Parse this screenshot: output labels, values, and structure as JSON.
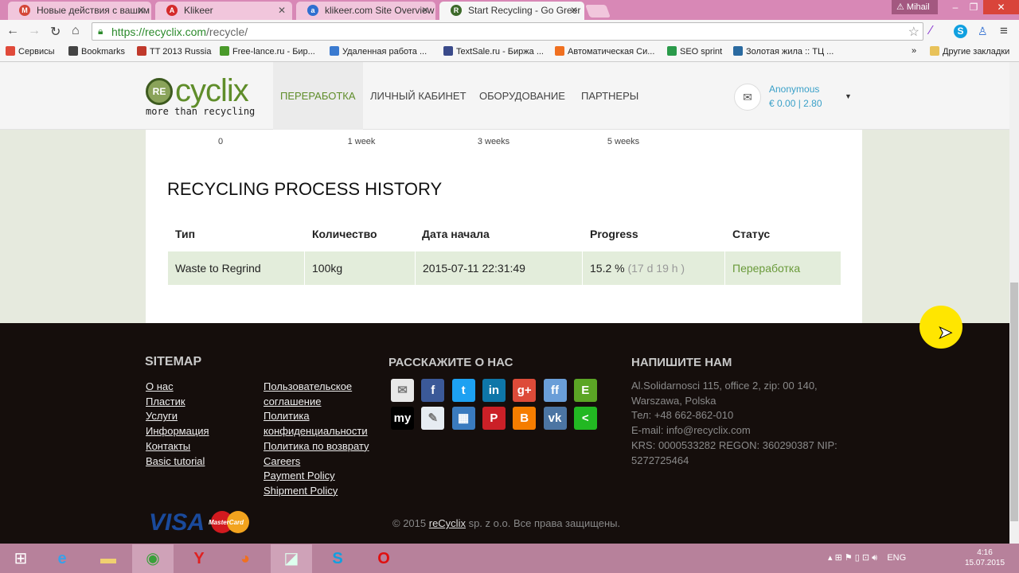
{
  "browser": {
    "tabs": [
      {
        "title": "Новые действия с вашим",
        "icon": "gmail-icon",
        "color": "#d44638",
        "glyph": "M"
      },
      {
        "title": "Klikeer",
        "icon": "klikeer-icon",
        "color": "#d42b2b",
        "glyph": "A"
      },
      {
        "title": "klikeer.com Site Overview",
        "icon": "site-overview-icon",
        "color": "#2f6fd0",
        "glyph": "a"
      },
      {
        "title": "Start Recycling - Go Greer",
        "icon": "recyclix-icon",
        "color": "#3d6a2a",
        "glyph": "R"
      }
    ],
    "user": "Mihail",
    "url_host": "https://recyclix.com",
    "url_path": "/recycle/",
    "bookmarks": [
      {
        "label": "Сервисы",
        "color": "#e04a3a"
      },
      {
        "label": "Bookmarks",
        "color": "#444"
      },
      {
        "label": "TT 2013 Russia",
        "color": "#c0392b"
      },
      {
        "label": "Free-lance.ru - Бир...",
        "color": "#4a9a2a"
      },
      {
        "label": "Удаленная работа ...",
        "color": "#3a7ad0"
      },
      {
        "label": "TextSale.ru - Биржа ...",
        "color": "#3a4a8a"
      },
      {
        "label": "Автоматическая Си...",
        "color": "#f07020"
      },
      {
        "label": "SEO sprint",
        "color": "#2a9a4a"
      },
      {
        "label": "Золотая жила :: ТЦ ...",
        "color": "#2a6aa0"
      }
    ],
    "more": "»",
    "other_bookmarks": "Другие закладки"
  },
  "site": {
    "logo_badge": "RE",
    "logo_word": "cyclix",
    "logo_tagline": "more than recycling",
    "nav": [
      "ПЕРЕРАБОТКА",
      "ЛИЧНЫЙ КАБИНЕТ",
      "ОБОРУДОВАНИЕ",
      "ПАРТНЕРЫ"
    ],
    "account_name": "Anonymous",
    "balance": "€ 0.00 | 2.80"
  },
  "timeline_ticks": [
    "0",
    "1 week",
    "3 weeks",
    "5 weeks"
  ],
  "history": {
    "title": "RECYCLING PROCESS HISTORY",
    "columns": [
      "Тип",
      "Количество",
      "Дата начала",
      "Progress",
      "Статус"
    ],
    "rows": [
      {
        "type": "Waste to Regrind",
        "qty": "100kg",
        "date": "2015-07-11 22:31:49",
        "progress": "15.2 %",
        "remaining": "(17 d 19 h )",
        "status": "Переработка"
      }
    ]
  },
  "footer": {
    "sitemap_title": "SITEMAP",
    "sitemap_col1": [
      "О нас",
      "Пластик",
      "Услуги",
      "Информация",
      "Контакты",
      "Basic tutorial"
    ],
    "sitemap_col2": [
      "Пользовательское",
      "соглашение",
      "Политика",
      "конфиденциальности",
      "Политика по возврату",
      "Careers",
      "Payment Policy",
      "Shipment Policy"
    ],
    "share_title": "РАССКАЖИТЕ О НАС",
    "social": [
      {
        "name": "email-icon",
        "color": "#e8e8e8",
        "glyph": "✉"
      },
      {
        "name": "facebook-icon",
        "color": "#3b5998",
        "glyph": "f"
      },
      {
        "name": "twitter-icon",
        "color": "#1da1f2",
        "glyph": "t"
      },
      {
        "name": "linkedin-icon",
        "color": "#0e76a8",
        "glyph": "in"
      },
      {
        "name": "google-plus-icon",
        "color": "#dd4b39",
        "glyph": "g+"
      },
      {
        "name": "friendfeed-icon",
        "color": "#6a9ed8",
        "glyph": "ff"
      },
      {
        "name": "evernote-icon",
        "color": "#5ba525",
        "glyph": "E"
      },
      {
        "name": "myspace-icon",
        "color": "#000000",
        "glyph": "my"
      },
      {
        "name": "livejournal-icon",
        "color": "#e6ecf2",
        "glyph": "✎"
      },
      {
        "name": "delicious-icon",
        "color": "#3a7bbf",
        "glyph": "▦"
      },
      {
        "name": "pinterest-icon",
        "color": "#cb2027",
        "glyph": "P"
      },
      {
        "name": "blogger-icon",
        "color": "#f57d00",
        "glyph": "B"
      },
      {
        "name": "vk-icon",
        "color": "#4c75a3",
        "glyph": "vk"
      },
      {
        "name": "share-icon",
        "color": "#22b822",
        "glyph": "<"
      }
    ],
    "contact_title": "НАПИШИТЕ НАМ",
    "contact_lines": [
      "Al.Solidarnosci 115, office 2, zip: 00 140,",
      "Warszawa, Polska",
      "Тел: +48 662-862-010",
      "E-mail: info@recyclix.com",
      "KRS: 0000533282 REGON: 360290387 NIP:",
      "5272725464"
    ],
    "copyright_prefix": "© 2015 ",
    "copyright_link": "reCyclix",
    "copyright_suffix": " sp. z o.o. Все права защищены.",
    "visa": "VISA",
    "mastercard": "MasterCard"
  },
  "taskbar": {
    "lang": "ENG",
    "time": "4:16",
    "date": "15.07.2015"
  }
}
